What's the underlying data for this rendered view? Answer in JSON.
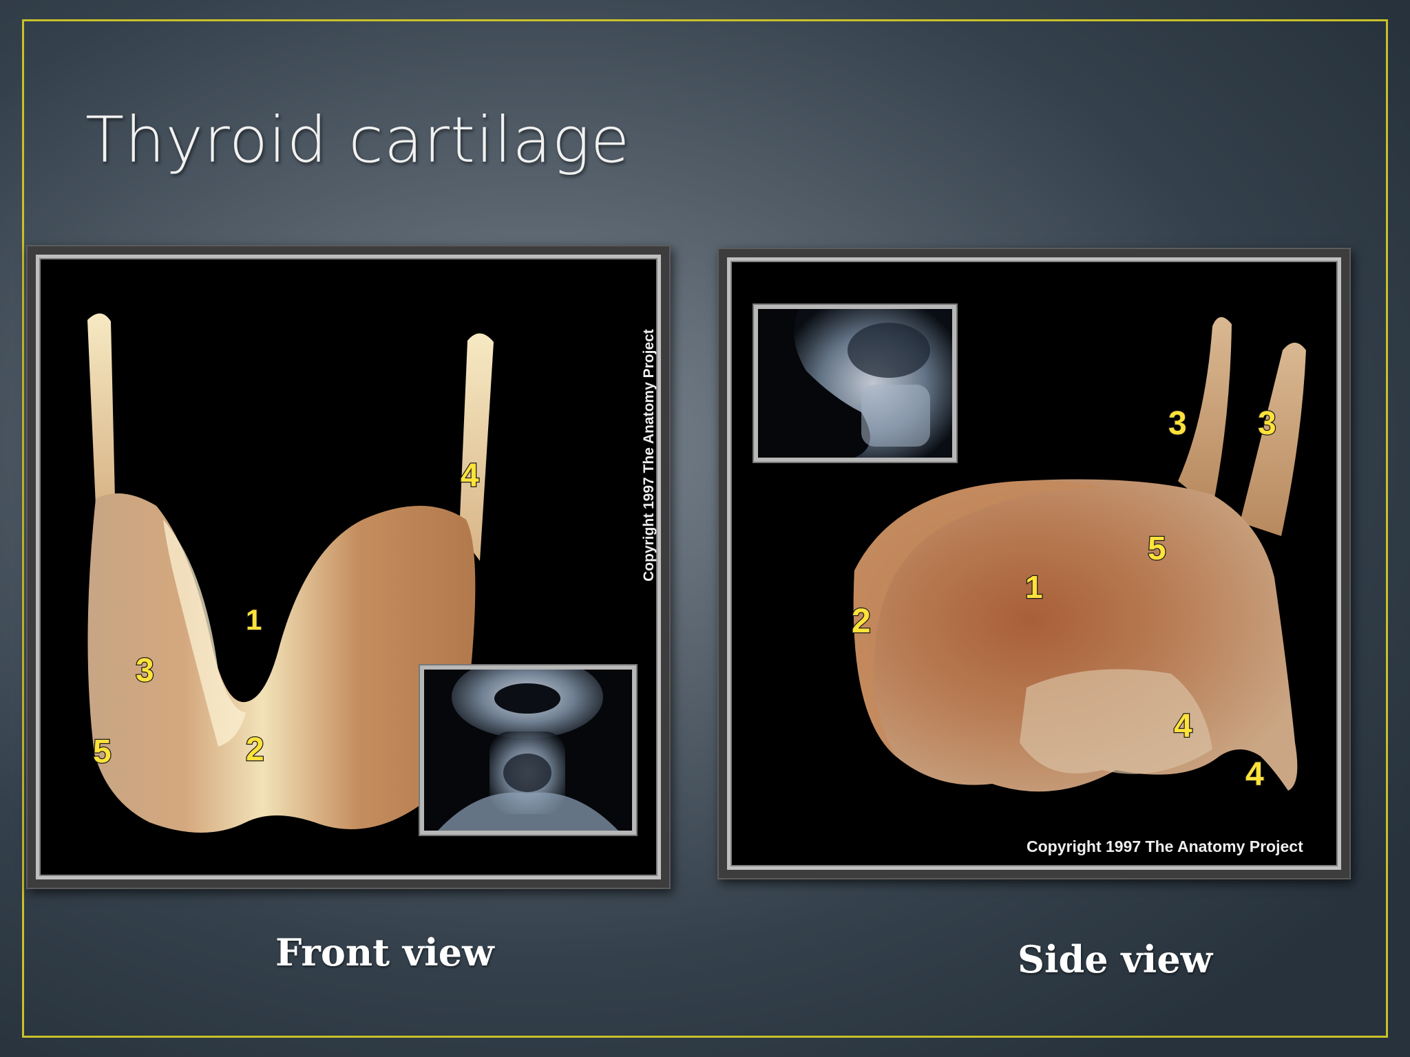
{
  "slide": {
    "title": "Thyroid cartilage",
    "border_color": "#c9c12a"
  },
  "front": {
    "caption": "Front view",
    "copyright": "Copyright 1997 The Anatomy Project",
    "labels": [
      "1",
      "2",
      "3",
      "4",
      "5"
    ]
  },
  "side": {
    "caption": "Side view",
    "copyright": "Copyright 1997 The Anatomy Project",
    "labels": [
      "1",
      "2",
      "3",
      "3",
      "4",
      "4",
      "5"
    ]
  }
}
